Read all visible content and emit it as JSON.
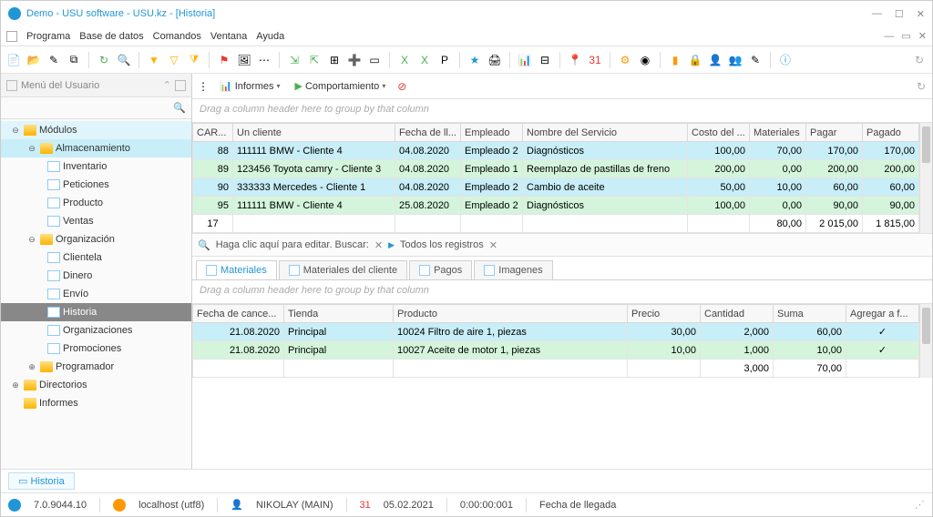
{
  "title": "Demo - USU software - USU.kz - [Historia]",
  "menu": [
    "Programa",
    "Base de datos",
    "Comandos",
    "Ventana",
    "Ayuda"
  ],
  "sidebar": {
    "title": "Menú del Usuario",
    "modulos": "Módulos",
    "almacen": "Almacenamiento",
    "almacen_items": [
      "Inventario",
      "Peticiones",
      "Producto",
      "Ventas"
    ],
    "org": "Organización",
    "org_items": [
      "Clientela",
      "Dinero",
      "Envío",
      "Historia",
      "Organizaciones",
      "Promociones"
    ],
    "programador": "Programador",
    "directorios": "Directorios",
    "informes": "Informes"
  },
  "subtb": {
    "informes": "Informes",
    "comport": "Comportamiento"
  },
  "group_hint": "Drag a column header here to group by that column",
  "cols1": [
    "CAR...",
    "Un cliente",
    "Fecha de ll...",
    "Empleado",
    "Nombre del Servicio",
    "Costo del ...",
    "Materiales",
    "Pagar",
    "Pagado"
  ],
  "rows1": [
    [
      "88",
      "111111 BMW - Cliente 4",
      "04.08.2020",
      "Empleado 2",
      "Diagnósticos",
      "100,00",
      "70,00",
      "170,00",
      "170,00"
    ],
    [
      "89",
      "123456 Toyota camry - Cliente 3",
      "04.08.2020",
      "Empleado 1",
      "Reemplazo de pastillas de freno",
      "200,00",
      "0,00",
      "200,00",
      "200,00"
    ],
    [
      "90",
      "333333 Mercedes - Cliente 1",
      "04.08.2020",
      "Empleado 2",
      "Cambio de aceite",
      "50,00",
      "10,00",
      "60,00",
      "60,00"
    ],
    [
      "95",
      "111111 BMW - Cliente 4",
      "25.08.2020",
      "Empleado 2",
      "Diagnósticos",
      "100,00",
      "0,00",
      "90,00",
      "90,00"
    ]
  ],
  "sum1": {
    "count": "17",
    "mat": "80,00",
    "pagar": "2 015,00",
    "pagado": "1 815,00"
  },
  "filter": {
    "edit": "Haga clic aquí para editar. Buscar:",
    "all": "Todos los registros"
  },
  "tabs2": [
    "Materiales",
    "Materiales del cliente",
    "Pagos",
    "Imagenes"
  ],
  "cols2": [
    "Fecha de cance...",
    "Tienda",
    "Producto",
    "Precio",
    "Cantidad",
    "Suma",
    "Agregar a f..."
  ],
  "rows2": [
    [
      "21.08.2020",
      "Principal",
      "10024 Filtro de aire 1, piezas",
      "30,00",
      "2,000",
      "60,00",
      "✓"
    ],
    [
      "21.08.2020",
      "Principal",
      "10027 Aceite de motor 1, piezas",
      "10,00",
      "1,000",
      "10,00",
      "✓"
    ]
  ],
  "sum2": {
    "cant": "3,000",
    "suma": "70,00"
  },
  "btab": "Historia",
  "status": {
    "ver": "7.0.9044.10",
    "host": "localhost (utf8)",
    "user": "NIKOLAY (MAIN)",
    "date": "05.02.2021",
    "time": "0:00:00:001",
    "field": "Fecha de llegada"
  }
}
